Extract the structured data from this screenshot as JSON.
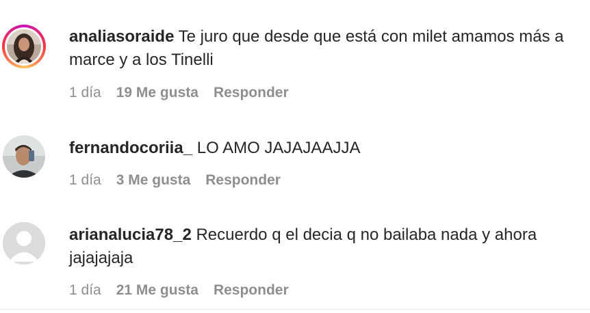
{
  "comments": [
    {
      "username": "analiasoraide",
      "text": "Te juro que desde que está con milet amamos más a marce y a los Tinelli",
      "age": "1 día",
      "likes": "19 Me gusta",
      "reply": "Responder",
      "avatar_icon": "profile-photo-woman",
      "has_story_ring": true
    },
    {
      "username": "fernandocoriia_",
      "text": "LO AMO JAJAJAAJJA",
      "age": "1 día",
      "likes": "3 Me gusta",
      "reply": "Responder",
      "avatar_icon": "profile-photo-man-selfie",
      "has_story_ring": false
    },
    {
      "username": "arianalucia78_2",
      "text": "Recuerdo q el decia q no bailaba nada y ahora jajajajaja",
      "age": "1 día",
      "likes": "21 Me gusta",
      "reply": "Responder",
      "avatar_icon": "default-user-icon",
      "has_story_ring": false
    }
  ],
  "colors": {
    "text": "#262626",
    "meta": "#8e8e8e",
    "default_avatar_bg": "#dbdbdb",
    "default_avatar_fg": "#ffffff"
  }
}
